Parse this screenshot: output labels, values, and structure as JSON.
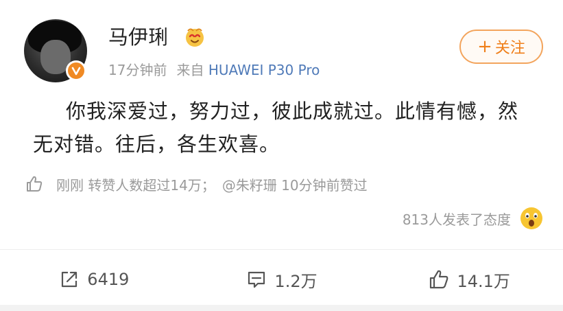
{
  "post": {
    "author": {
      "name": "马伊琍",
      "avatar_icon": "avatar-photo",
      "verified_icon": "verified-v-icon",
      "badge_icon": "member-badge-icon"
    },
    "time": "17分钟前",
    "source_prefix": "来自",
    "source_device": "HUAWEI P30 Pro",
    "follow_label": "关注",
    "follow_plus": "+",
    "text": "你我深爱过，努力过，彼此成就过。此情有憾，然无对错。往后，各生欢喜。",
    "like_info": {
      "part1": "刚刚 转赞人数超过14万；",
      "part2": "@朱籽珊 10分钟前赞过"
    },
    "attitude": {
      "text": "813人发表了态度",
      "emoji_icon": "surprised-face-emoji"
    },
    "actions": {
      "repost_count": "6419",
      "comment_count": "1.2万",
      "like_count": "14.1万"
    }
  },
  "colors": {
    "accent_orange": "#ef7f1a",
    "link_blue": "#4f7ab8",
    "meta_gray": "#9a9a9a"
  }
}
